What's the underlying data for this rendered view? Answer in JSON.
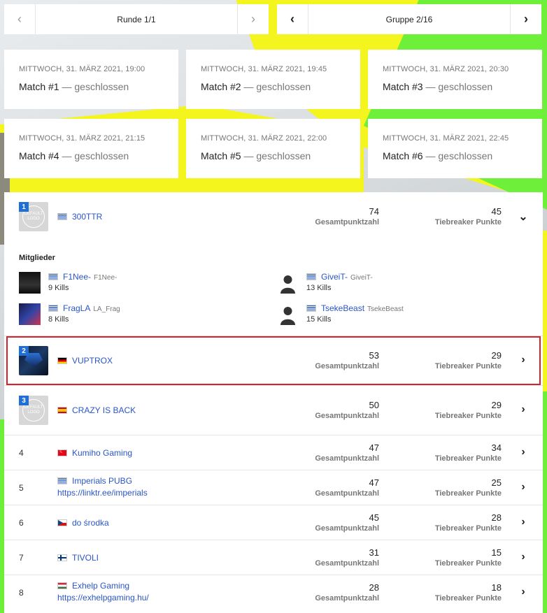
{
  "pagers": {
    "round": {
      "label": "Runde 1/1"
    },
    "group": {
      "label": "Gruppe 2/16"
    }
  },
  "matches": [
    {
      "date": "MITTWOCH, 31. MÄRZ 2021, 19:00",
      "title": "Match #1",
      "status": "— geschlossen"
    },
    {
      "date": "MITTWOCH, 31. MÄRZ 2021, 19:45",
      "title": "Match #2",
      "status": "— geschlossen"
    },
    {
      "date": "MITTWOCH, 31. MÄRZ 2021, 20:30",
      "title": "Match #3",
      "status": "— geschlossen"
    },
    {
      "date": "MITTWOCH, 31. MÄRZ 2021, 21:15",
      "title": "Match #4",
      "status": "— geschlossen"
    },
    {
      "date": "MITTWOCH, 31. MÄRZ 2021, 22:00",
      "title": "Match #5",
      "status": "— geschlossen"
    },
    {
      "date": "MITTWOCH, 31. MÄRZ 2021, 22:45",
      "title": "Match #6",
      "status": "— geschlossen"
    }
  ],
  "labels": {
    "points": "Gesamtpunktzahl",
    "tiebreaker": "Tiebreaker Punkte",
    "members": "Mitglieder",
    "logo_placeholder": "DEFAULT LOGO"
  },
  "standings": [
    {
      "rank": "1",
      "team": "300TTR",
      "flag": "greece-flag",
      "points": "74",
      "tiebreaker": "45"
    },
    {
      "rank": "2",
      "team": "VUPTROX",
      "flag": "germany-flag",
      "points": "53",
      "tiebreaker": "29"
    },
    {
      "rank": "3",
      "team": "CRAZY IS BACK",
      "flag": "spain-flag",
      "points": "50",
      "tiebreaker": "29"
    },
    {
      "rank": "4",
      "team": "Kumiho Gaming",
      "flag": "turkey-flag",
      "points": "47",
      "tiebreaker": "34"
    },
    {
      "rank": "5",
      "team": "Imperials PUBG",
      "flag": "greece-flag",
      "link": "https://linktr.ee/imperials",
      "points": "47",
      "tiebreaker": "25"
    },
    {
      "rank": "6",
      "team": "do środka",
      "flag": "czech-flag",
      "points": "45",
      "tiebreaker": "28"
    },
    {
      "rank": "7",
      "team": "TIVOLI",
      "flag": "finland-flag",
      "points": "31",
      "tiebreaker": "15"
    },
    {
      "rank": "8",
      "team": "Exhelp Gaming",
      "flag": "hungary-flag",
      "link": "https://exhelpgaming.hu/",
      "points": "28",
      "tiebreaker": "18"
    }
  ],
  "members": [
    {
      "name": "F1Nee-",
      "alias": "F1Nee-",
      "kills": "9 Kills"
    },
    {
      "name": "GiveiT-",
      "alias": "GiveiT-",
      "kills": "13 Kills"
    },
    {
      "name": "FragLA",
      "alias": "LA_Frag",
      "kills": "8 Kills"
    },
    {
      "name": "TsekeBeast",
      "alias": "TsekeBeast",
      "kills": "15 Kills"
    }
  ],
  "colors": {
    "link": "#2a55c7",
    "badge": "#1f6fd6",
    "highlight": "#d8202a",
    "yellow": "#f4f41e",
    "green": "#6ef03a"
  }
}
